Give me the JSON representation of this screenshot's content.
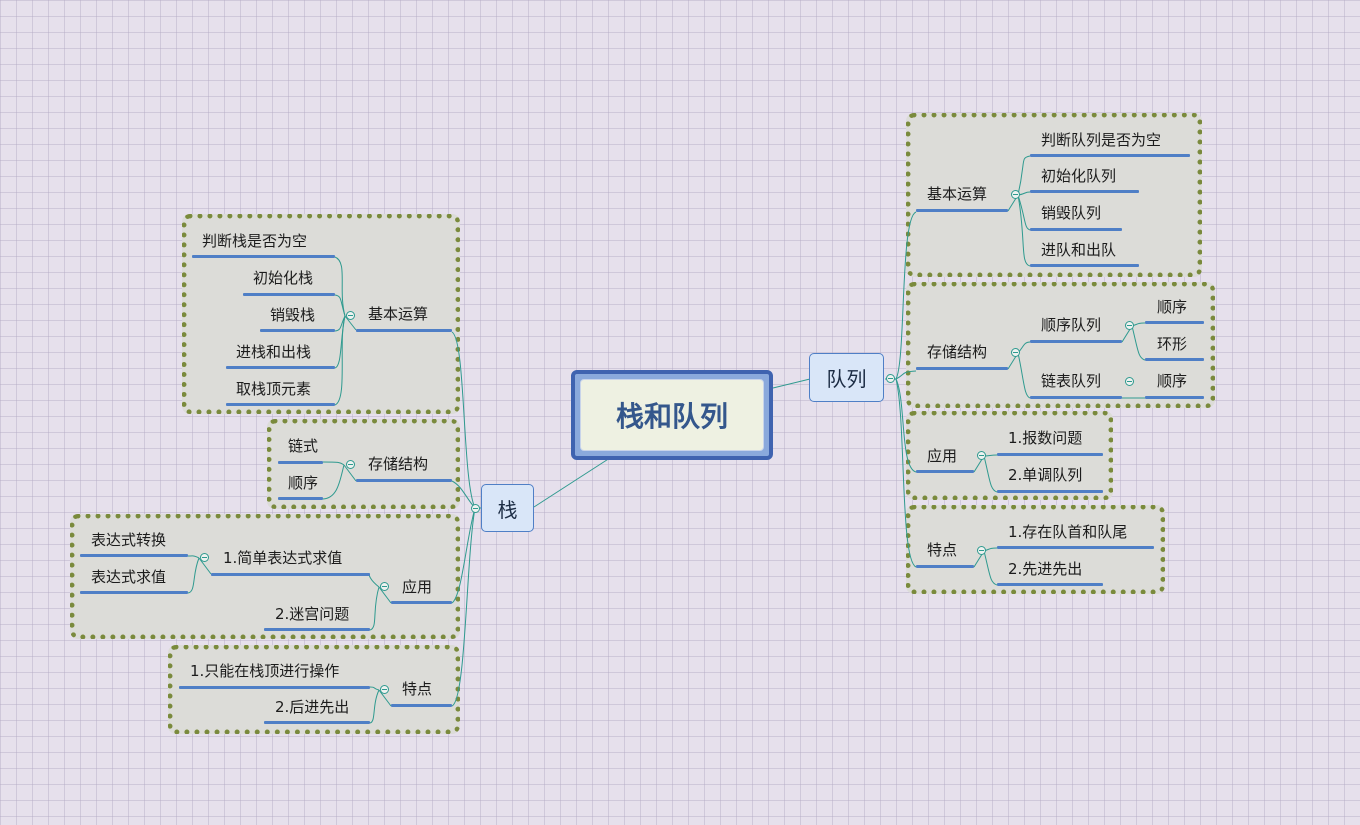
{
  "center": "栈和队列",
  "stack": {
    "label": "栈",
    "basic_ops": {
      "label": "基本运算",
      "items": [
        "判断栈是否为空",
        "初始化栈",
        "销毁栈",
        "进栈和出栈",
        "取栈顶元素"
      ]
    },
    "storage": {
      "label": "存储结构",
      "items": [
        "链式",
        "顺序"
      ]
    },
    "application": {
      "label": "应用",
      "simple_expr": {
        "label": "1.简单表达式求值",
        "items": [
          "表达式转换",
          "表达式求值"
        ]
      },
      "maze": "2.迷宫问题"
    },
    "features": {
      "label": "特点",
      "items": [
        "1.只能在栈顶进行操作",
        "2.后进先出"
      ]
    }
  },
  "queue": {
    "label": "队列",
    "basic_ops": {
      "label": "基本运算",
      "items": [
        "判断队列是否为空",
        "初始化队列",
        "销毁队列",
        "进队和出队"
      ]
    },
    "storage": {
      "label": "存储结构",
      "sequential": {
        "label": "顺序队列",
        "items": [
          "顺序",
          "环形"
        ]
      },
      "linked": {
        "label": "链表队列",
        "items": [
          "顺序"
        ]
      }
    },
    "application": {
      "label": "应用",
      "items": [
        "1.报数问题",
        "2.单调队列"
      ]
    },
    "features": {
      "label": "特点",
      "items": [
        "1.存在队首和队尾",
        "2.先进先出"
      ]
    }
  },
  "colors": {
    "box_border": "#7a8a3c",
    "underline": "#4f7fc6",
    "link": "#2f9a8f",
    "center_border": "#3f63b0"
  }
}
